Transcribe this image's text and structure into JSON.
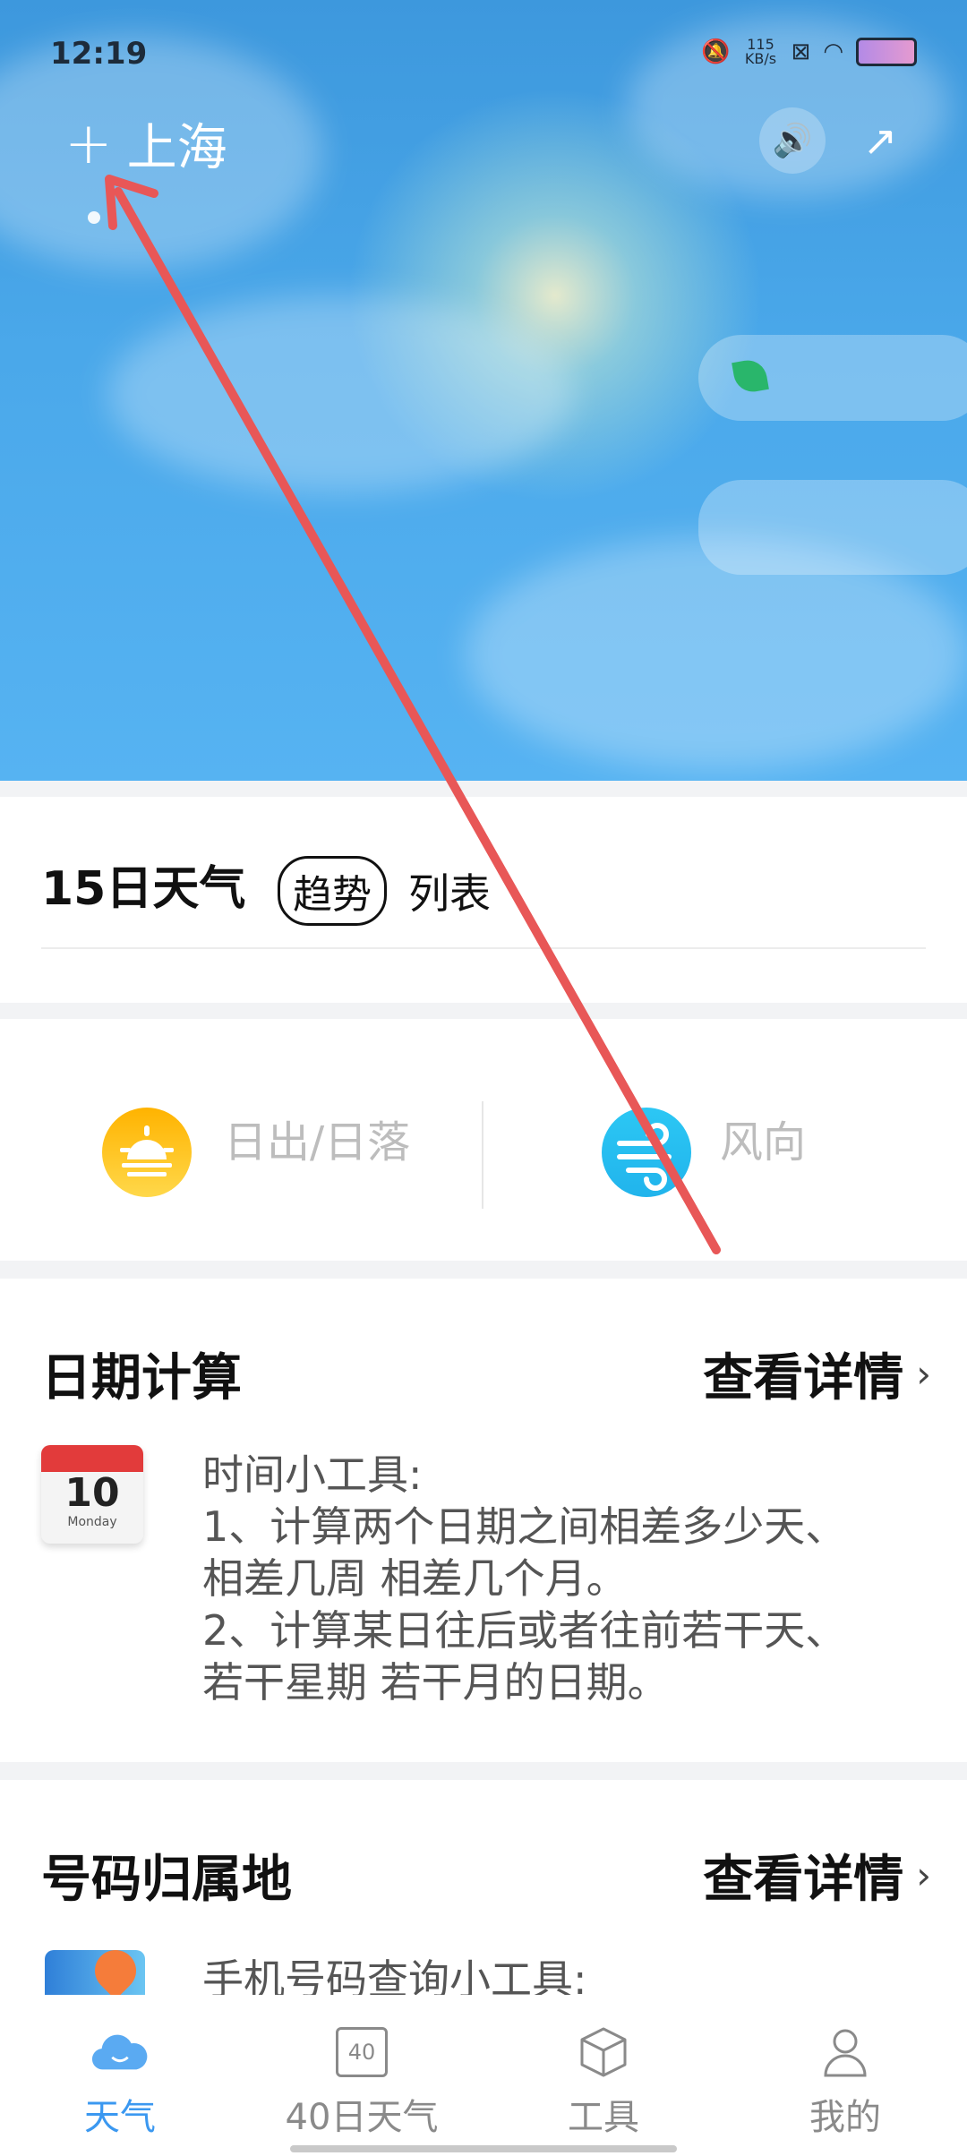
{
  "status": {
    "time": "12:19",
    "net_speed": "115 KB/s"
  },
  "hero": {
    "add_icon": "+",
    "city": "上海"
  },
  "forecast15": {
    "title": "15日天气",
    "tab_trend": "趋势",
    "tab_list": "列表"
  },
  "quick": {
    "sunrise_label": "日出/日落",
    "wind_label": "风向"
  },
  "date_calc": {
    "title": "日期计算",
    "more": "查看详情",
    "calendar_day": "10",
    "calendar_weekday": "Monday",
    "description": "时间小工具:\n1、计算两个日期之间相差多少天、\n相差几周 相差几个月。\n2、计算某日往后或者往前若干天、\n若干星期 若干月的日期。"
  },
  "phone_lookup": {
    "title": "号码归属地",
    "more": "查看详情",
    "description": "手机号码查询小工具:"
  },
  "tabs": [
    {
      "label": "天气",
      "icon": "cloud-icon",
      "active": true
    },
    {
      "label": "40日天气",
      "icon": "calendar-40-icon",
      "icon_text": "40"
    },
    {
      "label": "工具",
      "icon": "cube-icon"
    },
    {
      "label": "我的",
      "icon": "person-icon"
    }
  ],
  "colors": {
    "accent": "#3b98f0",
    "annotation": "#e85757"
  }
}
